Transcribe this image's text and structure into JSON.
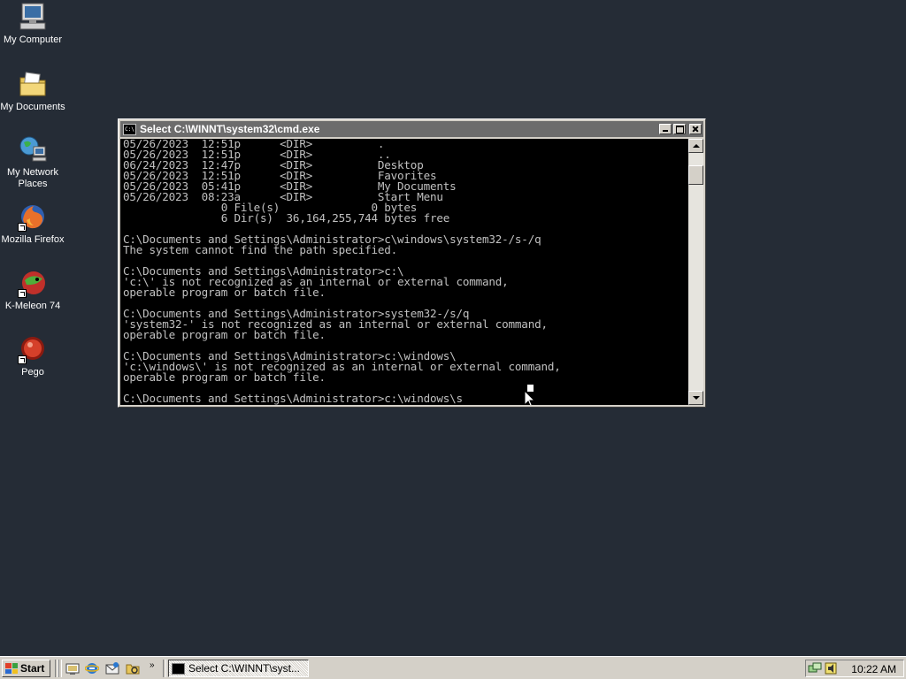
{
  "desktop": {
    "icons": [
      {
        "label": "My Computer",
        "icon": "my-computer-icon"
      },
      {
        "label": "My Documents",
        "icon": "my-documents-icon"
      },
      {
        "label": "My Network Places",
        "icon": "network-places-icon"
      },
      {
        "label": "Mozilla Firefox",
        "icon": "firefox-icon"
      },
      {
        "label": "K-Meleon 74",
        "icon": "k-meleon-icon"
      },
      {
        "label": "Pego",
        "icon": "pego-icon"
      }
    ]
  },
  "window": {
    "title": "Select C:\\WINNT\\system32\\cmd.exe",
    "console_text": "05/26/2023  12:51p      <DIR>          .\n05/26/2023  12:51p      <DIR>          ..\n06/24/2023  12:47p      <DIR>          Desktop\n05/26/2023  12:51p      <DIR>          Favorites\n05/26/2023  05:41p      <DIR>          My Documents\n05/26/2023  08:23a      <DIR>          Start Menu\n               0 File(s)              0 bytes\n               6 Dir(s)  36,164,255,744 bytes free\n\nC:\\Documents and Settings\\Administrator>c\\windows\\system32-/s-/q\nThe system cannot find the path specified.\n\nC:\\Documents and Settings\\Administrator>c:\\\n'c:\\' is not recognized as an internal or external command,\noperable program or batch file.\n\nC:\\Documents and Settings\\Administrator>system32-/s/q\n'system32-' is not recognized as an internal or external command,\noperable program or batch file.\n\nC:\\Documents and Settings\\Administrator>c:\\windows\\\n'c:\\windows\\' is not recognized as an internal or external command,\noperable program or batch file.\n\nC:\\Documents and Settings\\Administrator>c:\\windows\\s"
  },
  "taskbar": {
    "start_label": "Start",
    "quick_launch": [
      "show-desktop-icon",
      "internet-explorer-icon",
      "outlook-express-icon",
      "windows-explorer-icon"
    ],
    "more_label": "»",
    "task_label": "Select C:\\WINNT\\syst...",
    "clock": "10:22 AM"
  },
  "colors": {
    "desktop_bg": "#252c36",
    "titlebar_inactive": "#6c6c6c",
    "console_bg": "#000000",
    "console_fg": "#c0c0c0"
  }
}
